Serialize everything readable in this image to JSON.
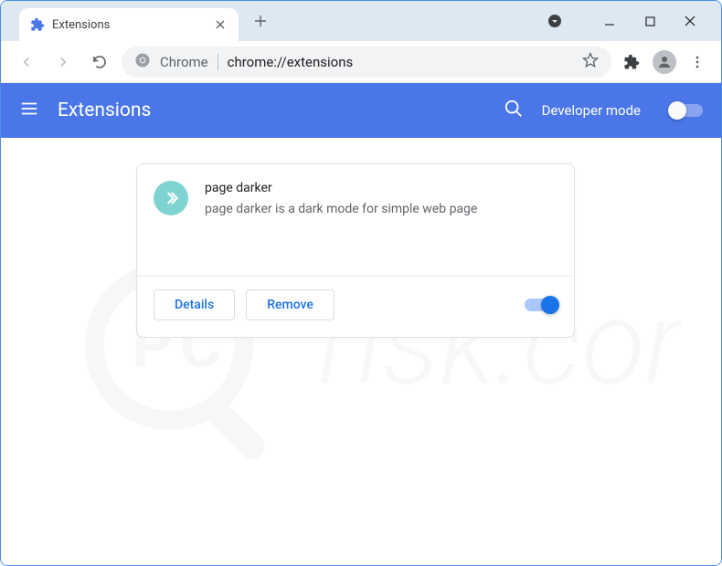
{
  "tab": {
    "title": "Extensions"
  },
  "omnibox": {
    "label": "Chrome",
    "url": "chrome://extensions"
  },
  "header": {
    "title": "Extensions",
    "developer_mode_label": "Developer mode"
  },
  "extension": {
    "name": "page darker",
    "description": "page darker is a dark mode for simple web page",
    "details_label": "Details",
    "remove_label": "Remove"
  }
}
